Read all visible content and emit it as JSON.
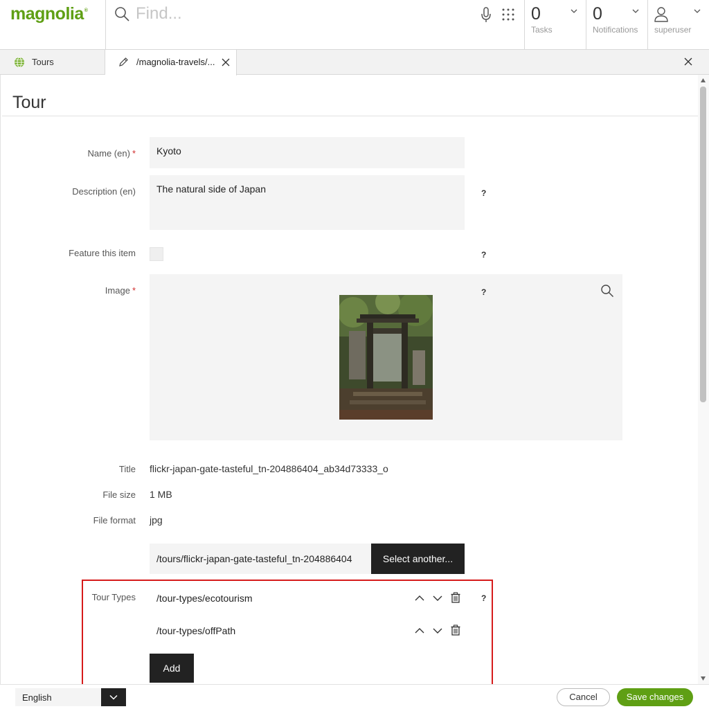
{
  "app": {
    "brand": "magnolia",
    "brand_color": "#5f9f14",
    "search_placeholder": "Find...",
    "tasks": {
      "count": "0",
      "label": "Tasks"
    },
    "notifications": {
      "count": "0",
      "label": "Notifications"
    },
    "user": {
      "name": "superuser"
    }
  },
  "tabs": [
    {
      "label": "Tours",
      "icon": "globe-icon"
    },
    {
      "label": "/magnolia-travels/...",
      "icon": "pencil-icon"
    }
  ],
  "form": {
    "title": "Tour",
    "name": {
      "label": "Name (en)",
      "required": "*",
      "value": "Kyoto"
    },
    "description": {
      "label": "Description (en)",
      "value": "The natural side of Japan",
      "help": "?"
    },
    "feature": {
      "label": "Feature this item",
      "checked": false,
      "help": "?"
    },
    "image": {
      "label": "Image",
      "required": "*",
      "help": "?"
    },
    "image_title": {
      "label": "Title",
      "value": "flickr-japan-gate-tasteful_tn-204886404_ab34d73333_o"
    },
    "file_size": {
      "label": "File size",
      "value": "1 MB"
    },
    "file_format": {
      "label": "File format",
      "value": "jpg"
    },
    "image_path": "/tours/flickr-japan-gate-tasteful_tn-204886404",
    "select_another": "Select another...",
    "tour_types": {
      "label": "Tour Types",
      "help": "?",
      "items": [
        "/tour-types/ecotourism",
        "/tour-types/offPath"
      ],
      "add_label": "Add"
    }
  },
  "footer": {
    "language": "English",
    "cancel": "Cancel",
    "save": "Save changes"
  }
}
